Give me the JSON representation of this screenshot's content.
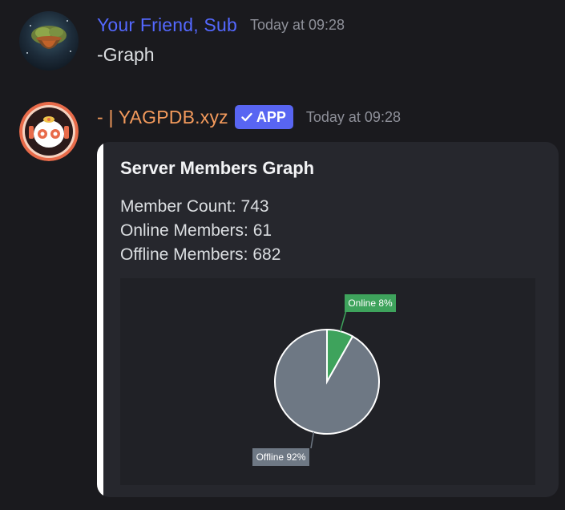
{
  "messages": [
    {
      "username": "Your Friend, Sub",
      "username_color": "#5468ff",
      "timestamp": "Today at 09:28",
      "text": "-Graph"
    },
    {
      "username": "- | YAGPDB.xyz",
      "username_color": "#f39a5c",
      "app_badge": "APP",
      "timestamp": "Today at 09:28",
      "embed": {
        "accent_color": "#ffffff",
        "title": "Server Members Graph",
        "lines": [
          "Member Count: 743",
          "Online Members: 61",
          "Offline Members: 682"
        ]
      }
    }
  ],
  "chart_data": {
    "type": "pie",
    "title": "",
    "slices": [
      {
        "label": "Online 8%",
        "value": 61,
        "percent": 8,
        "color": "#3ea35c"
      },
      {
        "label": "Offline 92%",
        "value": 682,
        "percent": 92,
        "color": "#6e7884"
      }
    ],
    "legend": false
  }
}
